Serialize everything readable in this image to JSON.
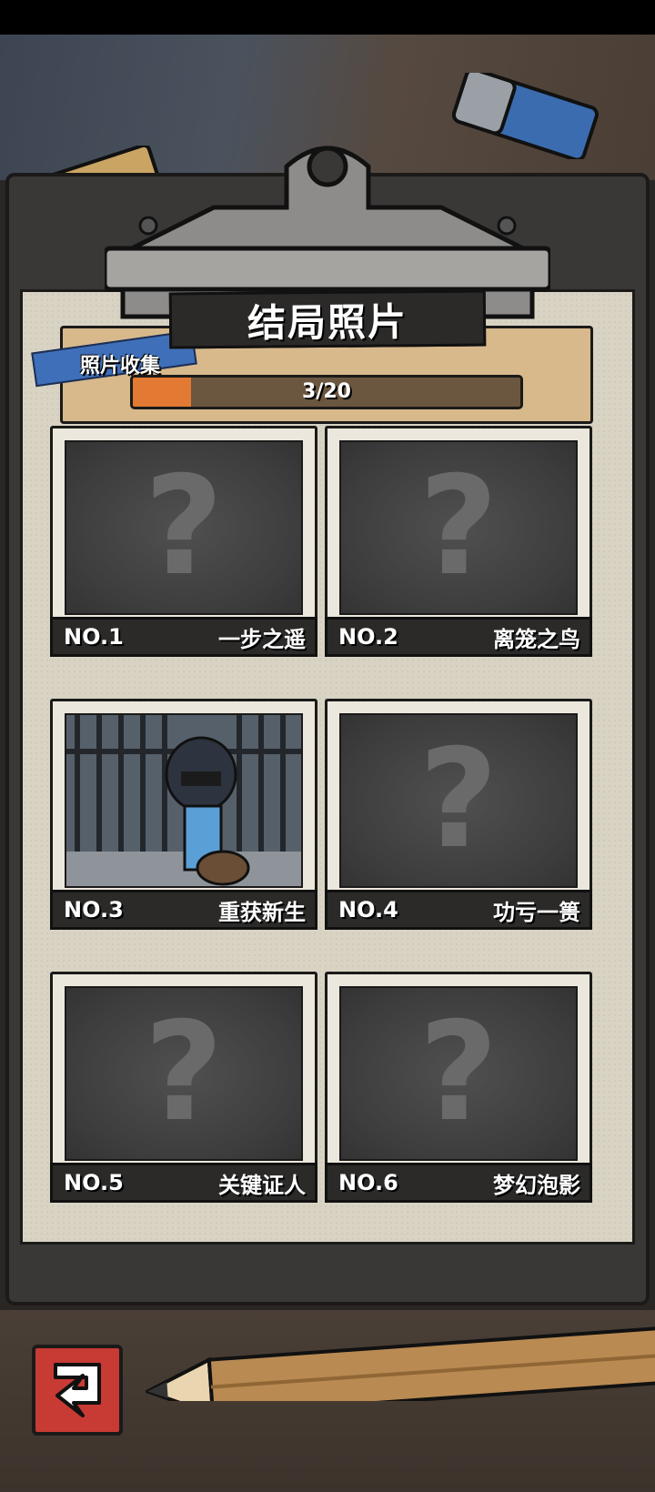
{
  "page": {
    "title": "结局照片",
    "collection_label": "照片收集",
    "progress": {
      "current": 3,
      "total": 20,
      "text": "3/20",
      "fill_fraction": 0.15
    }
  },
  "cards": [
    {
      "no": "NO.1",
      "name": "一步之遥",
      "unlocked": false
    },
    {
      "no": "NO.2",
      "name": "离笼之鸟",
      "unlocked": false
    },
    {
      "no": "NO.3",
      "name": "重获新生",
      "unlocked": true
    },
    {
      "no": "NO.4",
      "name": "功亏一篑",
      "unlocked": false
    },
    {
      "no": "NO.5",
      "name": "关键证人",
      "unlocked": false
    },
    {
      "no": "NO.6",
      "name": "梦幻泡影",
      "unlocked": false
    }
  ],
  "locked_symbol": "?",
  "colors": {
    "accent": "#e27a34",
    "back_button": "#c83a34",
    "tape": "#3f6fb8"
  },
  "icons": {
    "back": "back-arrow-icon",
    "locked": "question-mark-icon"
  }
}
